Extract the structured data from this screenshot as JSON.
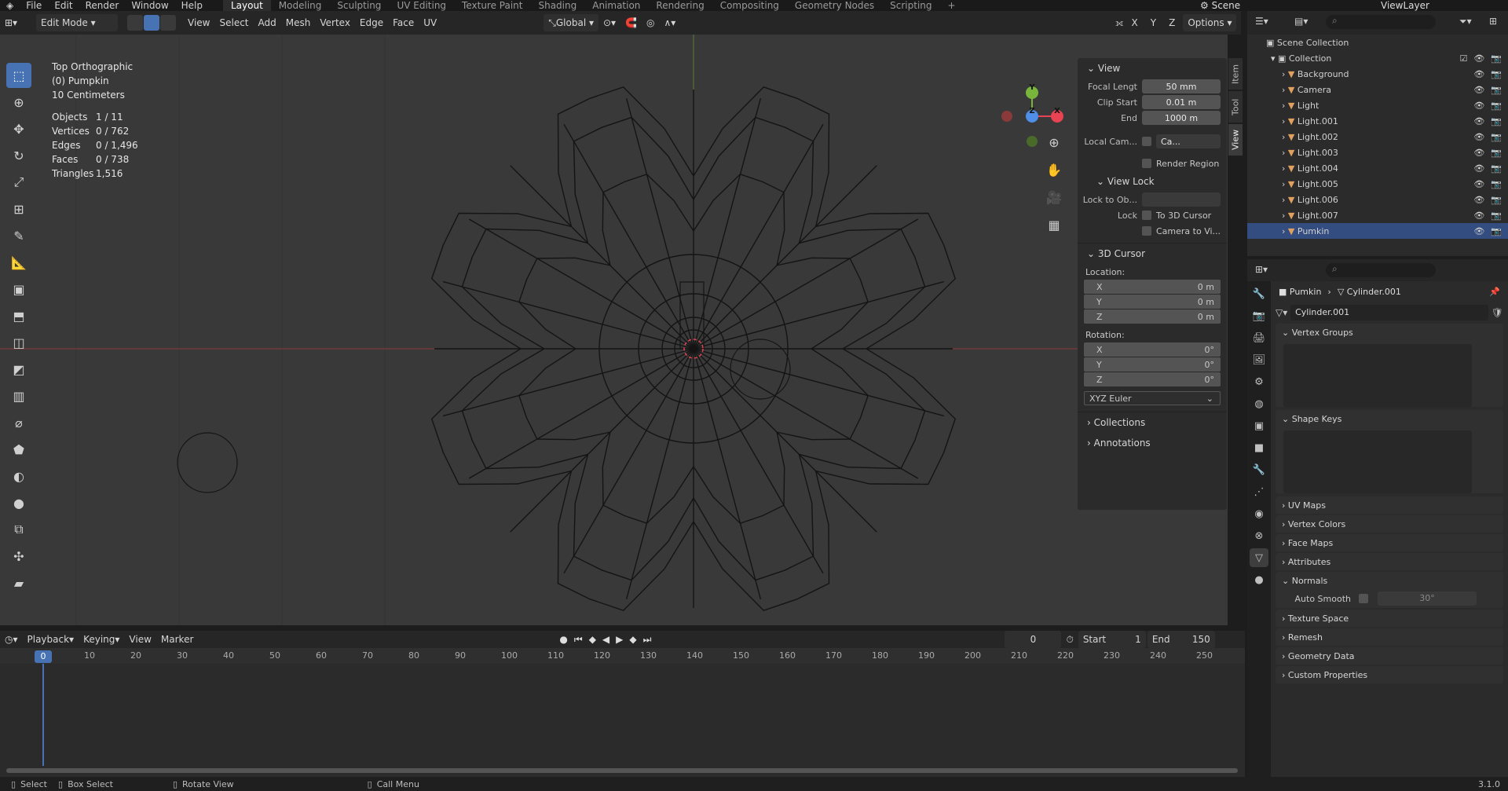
{
  "topbar": {
    "menus": [
      "File",
      "Edit",
      "Render",
      "Window",
      "Help"
    ],
    "workspaces": [
      "Layout",
      "Modeling",
      "Sculpting",
      "UV Editing",
      "Texture Paint",
      "Shading",
      "Animation",
      "Rendering",
      "Compositing",
      "Geometry Nodes",
      "Scripting"
    ],
    "active_workspace": "Layout",
    "scene": "Scene",
    "view_layer": "ViewLayer"
  },
  "viewport_header": {
    "mode": "Edit Mode",
    "menus": [
      "View",
      "Select",
      "Add",
      "Mesh",
      "Vertex",
      "Edge",
      "Face",
      "UV"
    ],
    "orientation": "Global",
    "axes": [
      "X",
      "Y",
      "Z"
    ],
    "options": "Options"
  },
  "overlay": {
    "view_name": "Top Orthographic",
    "object_name": "(0) Pumpkin",
    "scale": "10 Centimeters",
    "stats": [
      {
        "label": "Objects",
        "value": "1 / 11"
      },
      {
        "label": "Vertices",
        "value": "0 / 762"
      },
      {
        "label": "Edges",
        "value": "0 / 1,496"
      },
      {
        "label": "Faces",
        "value": "0 / 738"
      },
      {
        "label": "Triangles",
        "value": "1,516"
      }
    ]
  },
  "gizmo": {
    "x": "X",
    "y": "Y",
    "z": "Z"
  },
  "npanel": {
    "tabs": [
      "Item",
      "Tool",
      "View"
    ],
    "active_tab": "View",
    "view_section": "View",
    "focal_label": "Focal Lengt",
    "focal_value": "50 mm",
    "clip_start_label": "Clip Start",
    "clip_start_value": "0.01 m",
    "end_label": "End",
    "end_value": "1000 m",
    "local_cam_label": "Local Cam...",
    "local_cam_value": "Ca...",
    "render_region": "Render Region",
    "view_lock": "View Lock",
    "lock_to_obj": "Lock to Ob...",
    "lock_label": "Lock",
    "to_3d_cursor": "To 3D Cursor",
    "camera_to_view": "Camera to Vi...",
    "cursor_section": "3D Cursor",
    "location_label": "Location:",
    "loc": [
      {
        "axis": "X",
        "value": "0 m"
      },
      {
        "axis": "Y",
        "value": "0 m"
      },
      {
        "axis": "Z",
        "value": "0 m"
      }
    ],
    "rotation_label": "Rotation:",
    "rot": [
      {
        "axis": "X",
        "value": "0°"
      },
      {
        "axis": "Y",
        "value": "0°"
      },
      {
        "axis": "Z",
        "value": "0°"
      }
    ],
    "rotation_mode": "XYZ Euler",
    "collections": "Collections",
    "annotations": "Annotations"
  },
  "timeline": {
    "menus": [
      "Playback",
      "Keying",
      "View",
      "Marker"
    ],
    "current_frame": "0",
    "start_label": "Start",
    "start": "1",
    "end_label": "End",
    "end": "150",
    "ticks": [
      "0",
      "10",
      "20",
      "30",
      "40",
      "50",
      "60",
      "70",
      "80",
      "90",
      "100",
      "110",
      "120",
      "130",
      "140",
      "150",
      "160",
      "170",
      "180",
      "190",
      "200",
      "210",
      "220",
      "230",
      "240",
      "250"
    ]
  },
  "statusbar": {
    "select": "Select",
    "box_select": "Box Select",
    "rotate_view": "Rotate View",
    "call_menu": "Call Menu",
    "version": "3.1.0"
  },
  "outliner": {
    "scene_collection": "Scene Collection",
    "collection": "Collection",
    "items": [
      "Background",
      "Camera",
      "Light",
      "Light.001",
      "Light.002",
      "Light.003",
      "Light.004",
      "Light.005",
      "Light.006",
      "Light.007",
      "Pumkin"
    ],
    "selected": "Pumkin"
  },
  "properties": {
    "breadcrumb_object": "Pumkin",
    "breadcrumb_data": "Cylinder.001",
    "mesh_name": "Cylinder.001",
    "panels": {
      "vertex_groups": "Vertex Groups",
      "shape_keys": "Shape Keys",
      "uv_maps": "UV Maps",
      "vertex_colors": "Vertex Colors",
      "face_maps": "Face Maps",
      "attributes": "Attributes",
      "normals": "Normals",
      "auto_smooth": "Auto Smooth",
      "auto_smooth_angle": "30°",
      "texture_space": "Texture Space",
      "remesh": "Remesh",
      "geometry_data": "Geometry Data",
      "custom_properties": "Custom Properties"
    }
  },
  "colors": {
    "accent": "#4772b3",
    "x_axis": "#e84352",
    "y_axis": "#7ab53b",
    "z_axis": "#4f8fe8"
  }
}
